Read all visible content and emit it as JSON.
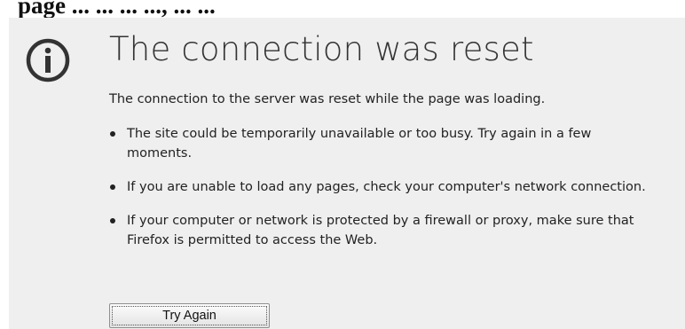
{
  "header_text": "page ... ... ... ..., ... ...",
  "error": {
    "icon": "info-icon",
    "title": "The connection was reset",
    "intro": "The connection to the server was reset while the page was loading.",
    "bullets": [
      "The site could be temporarily unavailable or too busy. Try again in a few moments.",
      "If you are unable to load any pages, check your computer's network connection.",
      "If your computer or network is protected by a firewall or proxy, make sure that Firefox is permitted to access the Web."
    ],
    "button_label": "Try Again"
  },
  "colors": {
    "panel_background": "#efefef",
    "icon": "#333333",
    "text": "#222222"
  }
}
